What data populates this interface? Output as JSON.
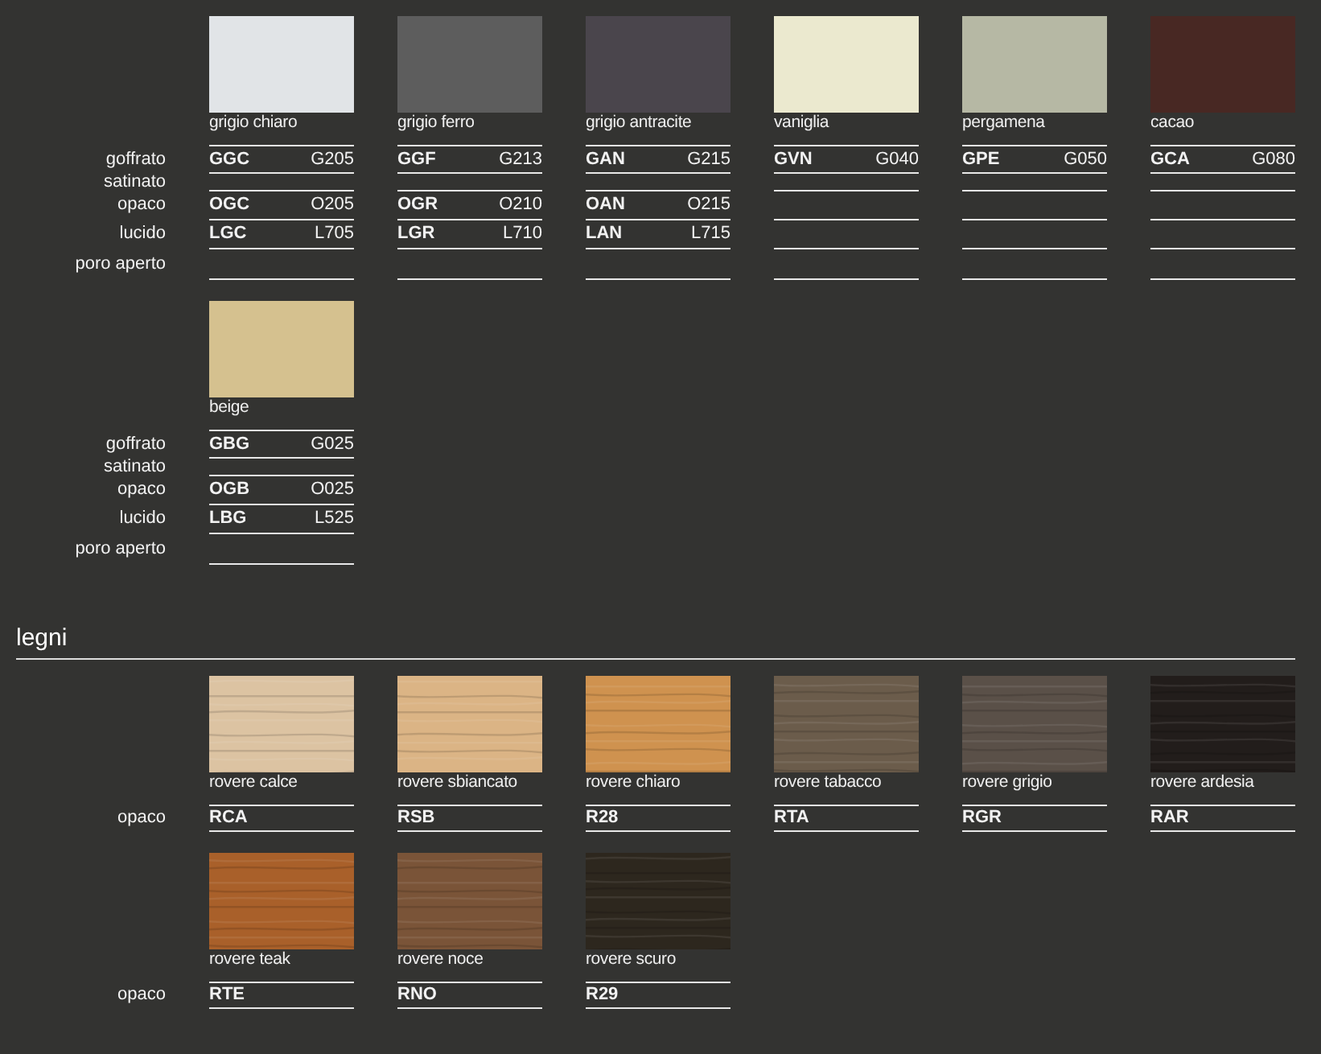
{
  "sections": [
    {
      "blocks": [
        {
          "finishes": [
            "goffrato",
            "satinato",
            "opaco",
            "lucido",
            "poro aperto"
          ],
          "swatches": [
            {
              "kind": "solid",
              "name": "grigio chiaro",
              "color": "#e1e4e7",
              "codes": [
                {
                  "kind": "code",
                  "code": "GGC",
                  "number": "G205"
                },
                {
                  "kind": "blank"
                },
                {
                  "kind": "code",
                  "code": "OGC",
                  "number": "O205"
                },
                {
                  "kind": "code",
                  "code": "LGC",
                  "number": "L705"
                },
                {
                  "kind": "blank"
                }
              ]
            },
            {
              "kind": "solid",
              "name": "grigio ferro",
              "color": "#5d5d5d",
              "codes": [
                {
                  "kind": "code",
                  "code": "GGF",
                  "number": "G213"
                },
                {
                  "kind": "blank"
                },
                {
                  "kind": "code",
                  "code": "OGR",
                  "number": "O210"
                },
                {
                  "kind": "code",
                  "code": "LGR",
                  "number": "L710"
                },
                {
                  "kind": "blank"
                }
              ]
            },
            {
              "kind": "solid",
              "name": "grigio antracite",
              "color": "#4a454c",
              "codes": [
                {
                  "kind": "code",
                  "code": "GAN",
                  "number": "G215"
                },
                {
                  "kind": "blank"
                },
                {
                  "kind": "code",
                  "code": "OAN",
                  "number": "O215"
                },
                {
                  "kind": "code",
                  "code": "LAN",
                  "number": "L715"
                },
                {
                  "kind": "blank"
                }
              ]
            },
            {
              "kind": "solid",
              "name": "vaniglia",
              "color": "#ebe9cf",
              "codes": [
                {
                  "kind": "code",
                  "code": "GVN",
                  "number": "G040"
                },
                {
                  "kind": "blank"
                },
                {
                  "kind": "blank"
                },
                {
                  "kind": "blank"
                },
                {
                  "kind": "blank"
                }
              ]
            },
            {
              "kind": "solid",
              "name": "pergamena",
              "color": "#b6b8a4",
              "codes": [
                {
                  "kind": "code",
                  "code": "GPE",
                  "number": "G050"
                },
                {
                  "kind": "blank"
                },
                {
                  "kind": "blank"
                },
                {
                  "kind": "blank"
                },
                {
                  "kind": "blank"
                }
              ]
            },
            {
              "kind": "solid",
              "name": "cacao",
              "color": "#482823",
              "codes": [
                {
                  "kind": "code",
                  "code": "GCA",
                  "number": "G080"
                },
                {
                  "kind": "blank"
                },
                {
                  "kind": "blank"
                },
                {
                  "kind": "blank"
                },
                {
                  "kind": "blank"
                }
              ]
            }
          ]
        },
        {
          "finishes": [
            "goffrato",
            "satinato",
            "opaco",
            "lucido",
            "poro aperto"
          ],
          "swatches": [
            {
              "kind": "solid",
              "name": "beige",
              "color": "#d5c18f",
              "codes": [
                {
                  "kind": "code",
                  "code": "GBG",
                  "number": "G025"
                },
                {
                  "kind": "blank"
                },
                {
                  "kind": "code",
                  "code": "OGB",
                  "number": "O025"
                },
                {
                  "kind": "code",
                  "code": "LBG",
                  "number": "L525"
                },
                {
                  "kind": "blank"
                }
              ]
            }
          ]
        }
      ]
    },
    {
      "title": "legni",
      "blocks": [
        {
          "finishes": [
            "opaco"
          ],
          "swatches": [
            {
              "kind": "wood",
              "name": "rovere calce",
              "color": "#dcc3a2",
              "codes": [
                {
                  "kind": "code",
                  "code": "RCA"
                }
              ]
            },
            {
              "kind": "wood",
              "name": "rovere sbiancato",
              "color": "#dbb485",
              "codes": [
                {
                  "kind": "code",
                  "code": "RSB"
                }
              ]
            },
            {
              "kind": "wood",
              "name": "rovere chiaro",
              "color": "#cf924f",
              "codes": [
                {
                  "kind": "code",
                  "code": "R28"
                }
              ]
            },
            {
              "kind": "wood",
              "name": "rovere tabacco",
              "color": "#6b5c4b",
              "codes": [
                {
                  "kind": "code",
                  "code": "RTA"
                }
              ]
            },
            {
              "kind": "wood",
              "name": "rovere grigio",
              "color": "#5a5048",
              "codes": [
                {
                  "kind": "code",
                  "code": "RGR"
                }
              ]
            },
            {
              "kind": "wood",
              "name": "rovere ardesia",
              "color": "#221d1b",
              "codes": [
                {
                  "kind": "code",
                  "code": "RAR"
                }
              ]
            }
          ]
        },
        {
          "finishes": [
            "opaco"
          ],
          "swatches": [
            {
              "kind": "wood",
              "name": "rovere teak",
              "color": "#a9602a",
              "codes": [
                {
                  "kind": "code",
                  "code": "RTE"
                }
              ]
            },
            {
              "kind": "wood",
              "name": "rovere noce",
              "color": "#7a5438",
              "codes": [
                {
                  "kind": "code",
                  "code": "RNO"
                }
              ]
            },
            {
              "kind": "wood",
              "name": "rovere scuro",
              "color": "#2d271e",
              "codes": [
                {
                  "kind": "code",
                  "code": "R29"
                }
              ]
            }
          ]
        }
      ]
    }
  ]
}
